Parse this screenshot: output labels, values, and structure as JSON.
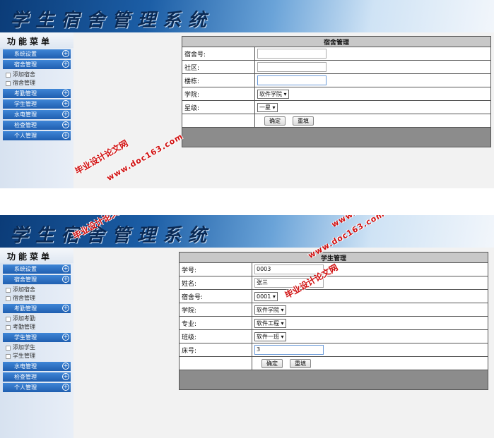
{
  "app_title": "学生宿舍管理系统",
  "sidebar": {
    "title": "功能菜单",
    "plus": "+",
    "items": {
      "system": "系统设置",
      "dorm": "宿舍管理",
      "add_dorm": "添加宿舍",
      "dorm_manage": "宿舍管理",
      "attendance": "考勤管理",
      "add_attendance": "添加考勤",
      "attendance_manage": "考勤管理",
      "student": "学生管理",
      "add_student": "添加学生",
      "student_manage": "学生管理",
      "utility": "水电管理",
      "inspection": "检查管理",
      "personal": "个人管理"
    }
  },
  "dorm_form": {
    "header": "宿舍管理",
    "dorm_no_label": "宿舍号:",
    "community_label": "社区:",
    "building_label": "楼栋:",
    "college_label": "学院:",
    "college_value": "软件学院 ▾",
    "star_label": "星级:",
    "star_value": "一星 ▾",
    "confirm": "确定",
    "reset": "重填"
  },
  "student_form": {
    "header": "学生管理",
    "id_label": "学号:",
    "id_value": "0003",
    "name_label": "姓名:",
    "name_value": "张三",
    "dorm_label": "宿舍号:",
    "dorm_value": "0001 ▾",
    "college_label": "学院:",
    "college_value": "软件学院 ▾",
    "major_label": "专业:",
    "major_value": "软件工程 ▾",
    "class_label": "班级:",
    "class_value": "软件一班 ▾",
    "bed_label": "床号:",
    "bed_value": "3",
    "confirm": "确定",
    "reset": "重填"
  },
  "watermark": {
    "site": "www.doc163.com",
    "name": "毕业设计论文网"
  }
}
